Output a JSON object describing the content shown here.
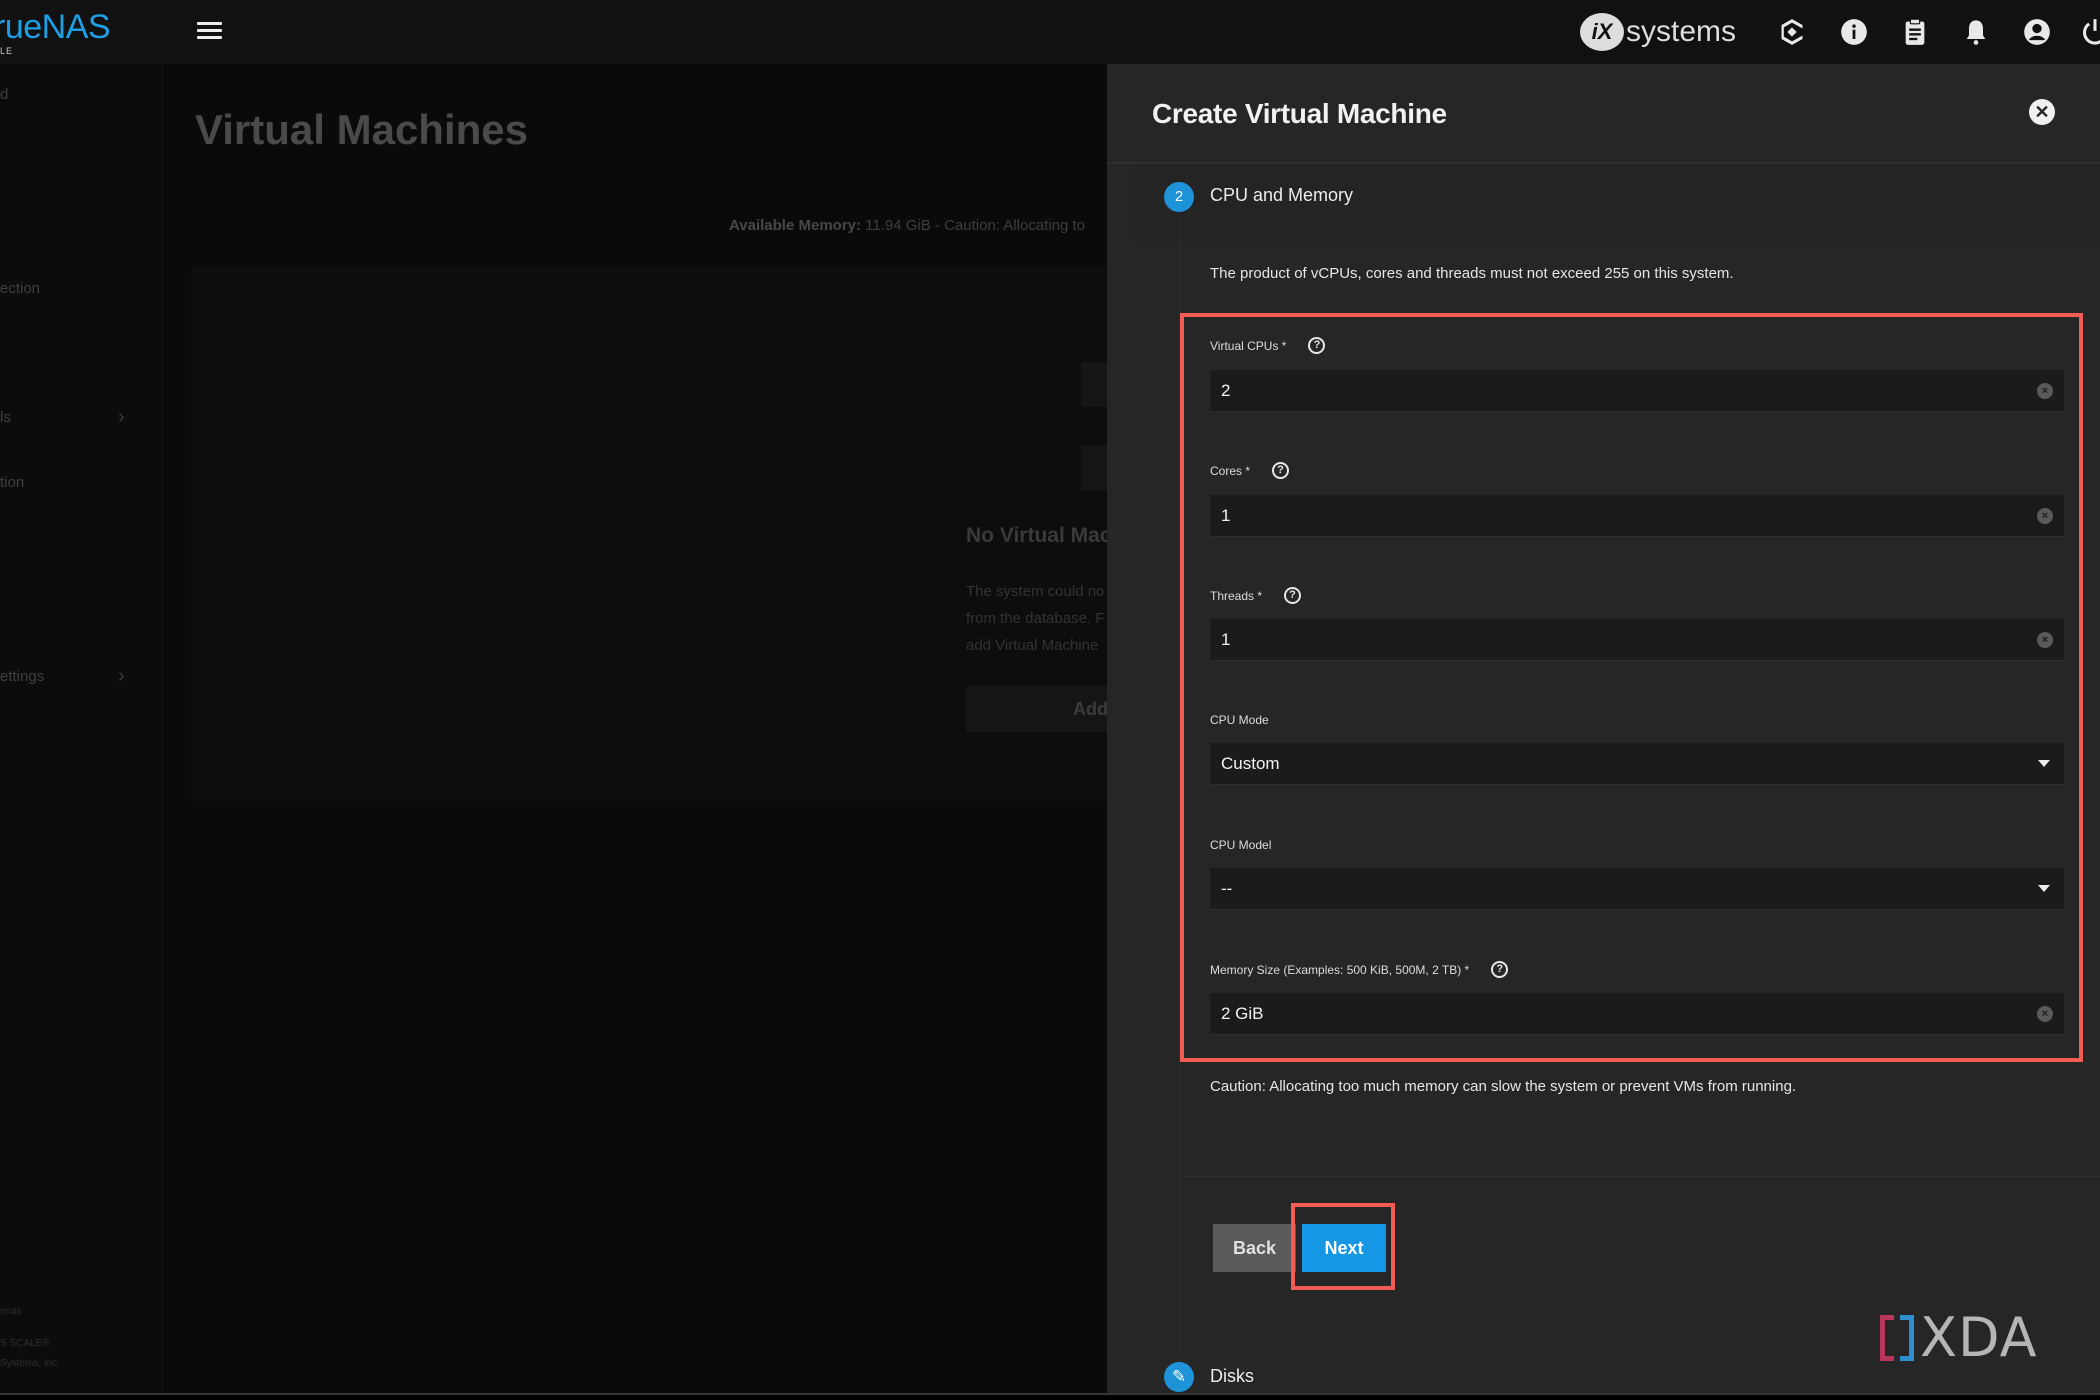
{
  "topbar": {
    "logo_text": "rueNAS",
    "logo_sub": "LE",
    "brand_mark": "iX",
    "brand_text": "systems",
    "icons": [
      "truecommand-icon",
      "info-icon",
      "clipboard-icon",
      "bell-icon",
      "account-icon",
      "power-icon"
    ]
  },
  "sidebar": {
    "items": [
      {
        "label": "d",
        "has_chevron": false
      },
      {
        "label": "ection",
        "has_chevron": false
      },
      {
        "label": "ls",
        "has_chevron": true
      },
      {
        "label": "tion",
        "has_chevron": false
      },
      {
        "label": "ettings",
        "has_chevron": true
      }
    ],
    "chevron": "›",
    "footer": [
      "enas",
      "S SCALE®",
      "Systems, Inc."
    ]
  },
  "main": {
    "page_title": "Virtual Machines",
    "available_memory_label": "Available Memory:",
    "available_memory_value": "11.94 GiB - Caution: Allocating to",
    "empty_title": "No Virtual Mach",
    "empty_text": [
      "The system could no",
      "from the database. F",
      "add Virtual Machine"
    ],
    "empty_add_label": "Add"
  },
  "panel": {
    "title": "Create Virtual Machine",
    "close_glyph": "✕",
    "step": {
      "number": "2",
      "label": "CPU and Memory",
      "note": "The product of vCPUs, cores and threads must not exceed 255 on this system."
    },
    "fields": {
      "vcpus": {
        "label": "Virtual CPUs *",
        "value": "2"
      },
      "cores": {
        "label": "Cores *",
        "value": "1"
      },
      "threads": {
        "label": "Threads *",
        "value": "1"
      },
      "cpu_mode": {
        "label": "CPU Mode",
        "value": "Custom"
      },
      "cpu_model": {
        "label": "CPU Model",
        "value": "--"
      },
      "memory": {
        "label": "Memory Size (Examples: 500 KiB, 500M, 2 TB) *",
        "value": "2 GiB"
      }
    },
    "help_glyph": "?",
    "clear_glyph": "×",
    "caution": "Caution: Allocating too much memory can slow the system or prevent VMs from running.",
    "back_label": "Back",
    "next_label": "Next",
    "next_step": {
      "label": "Disks",
      "icon_glyph": "✎"
    }
  },
  "watermark": {
    "text": "XDA"
  },
  "colors": {
    "accent": "#1597e5",
    "highlight": "#f25c55",
    "panel_bg": "#262626",
    "field_bg": "#1b1b1b"
  }
}
